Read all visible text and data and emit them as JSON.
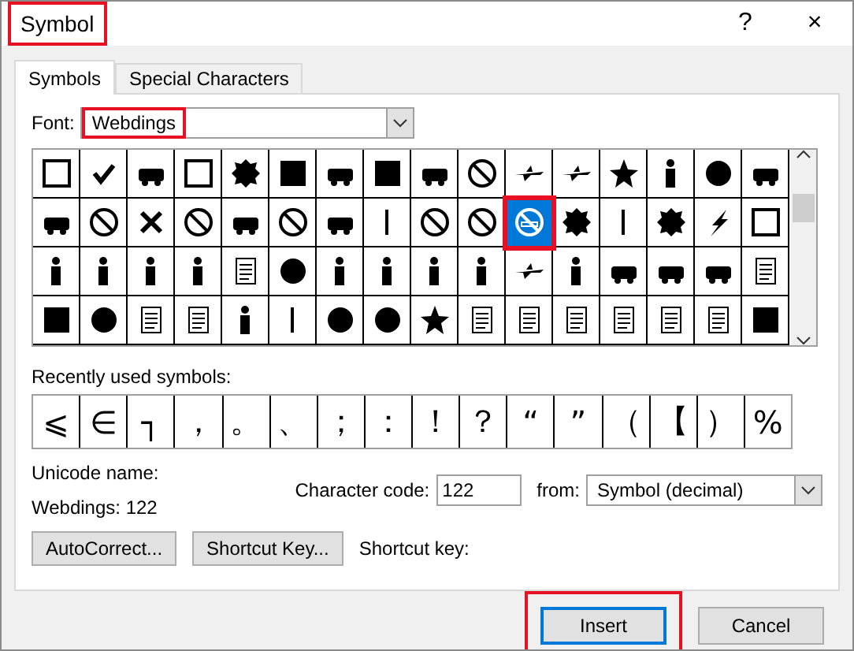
{
  "window": {
    "title": "Symbol",
    "title_highlighted": true,
    "help": "?",
    "close": "×"
  },
  "tabs": [
    {
      "label": "Symbols",
      "selected": true
    },
    {
      "label": "Special Characters",
      "selected": false
    }
  ],
  "font": {
    "label": "Font:",
    "value": "Webdings",
    "highlighted": true
  },
  "symbol_grid": {
    "cells": [
      {
        "selected": false
      },
      {
        "selected": false
      },
      {
        "selected": false
      },
      {
        "selected": false
      },
      {
        "selected": false
      },
      {
        "selected": false
      },
      {
        "selected": false
      },
      {
        "selected": false
      },
      {
        "selected": false
      },
      {
        "selected": false
      },
      {
        "selected": false
      },
      {
        "selected": false
      },
      {
        "selected": false
      },
      {
        "selected": false
      },
      {
        "selected": false
      },
      {
        "selected": false
      },
      {
        "selected": false
      },
      {
        "selected": false
      },
      {
        "selected": false
      },
      {
        "selected": false
      },
      {
        "selected": false
      },
      {
        "selected": false
      },
      {
        "selected": false
      },
      {
        "selected": false
      },
      {
        "selected": false
      },
      {
        "selected": false
      },
      {
        "selected": true
      },
      {
        "selected": false
      },
      {
        "selected": false
      },
      {
        "selected": false
      },
      {
        "selected": false
      },
      {
        "selected": false
      },
      {
        "selected": false
      },
      {
        "selected": false
      },
      {
        "selected": false
      },
      {
        "selected": false
      },
      {
        "selected": false
      },
      {
        "selected": false
      },
      {
        "selected": false
      },
      {
        "selected": false
      },
      {
        "selected": false
      },
      {
        "selected": false
      },
      {
        "selected": false
      },
      {
        "selected": false
      },
      {
        "selected": false
      },
      {
        "selected": false
      },
      {
        "selected": false
      },
      {
        "selected": false
      },
      {
        "selected": false
      },
      {
        "selected": false
      },
      {
        "selected": false
      },
      {
        "selected": false
      },
      {
        "selected": false
      },
      {
        "selected": false
      },
      {
        "selected": false
      },
      {
        "selected": false
      },
      {
        "selected": false
      },
      {
        "selected": false
      },
      {
        "selected": false
      },
      {
        "selected": false
      },
      {
        "selected": false
      },
      {
        "selected": false
      },
      {
        "selected": false
      },
      {
        "selected": false
      }
    ]
  },
  "recent": {
    "label": "Recently used symbols:",
    "symbols": [
      "⩽",
      "∈",
      "┐",
      "，",
      "。",
      "、",
      "；",
      "：",
      "！",
      "？",
      "“",
      "”",
      "（",
      "【",
      "）",
      "%"
    ]
  },
  "unicode_name": {
    "label": "Unicode name:",
    "value": "Webdings: 122"
  },
  "character_code": {
    "label": "Character code:",
    "value": "122"
  },
  "from": {
    "label": "from:",
    "value": "Symbol (decimal)"
  },
  "buttons": [
    {
      "label": "AutoCorrect..."
    },
    {
      "label": "Shortcut Key..."
    }
  ],
  "shortcut_key": {
    "label": "Shortcut key:"
  },
  "footer": [
    {
      "label": "Insert",
      "default": true,
      "highlighted": true
    },
    {
      "label": "Cancel",
      "default": false
    }
  ]
}
